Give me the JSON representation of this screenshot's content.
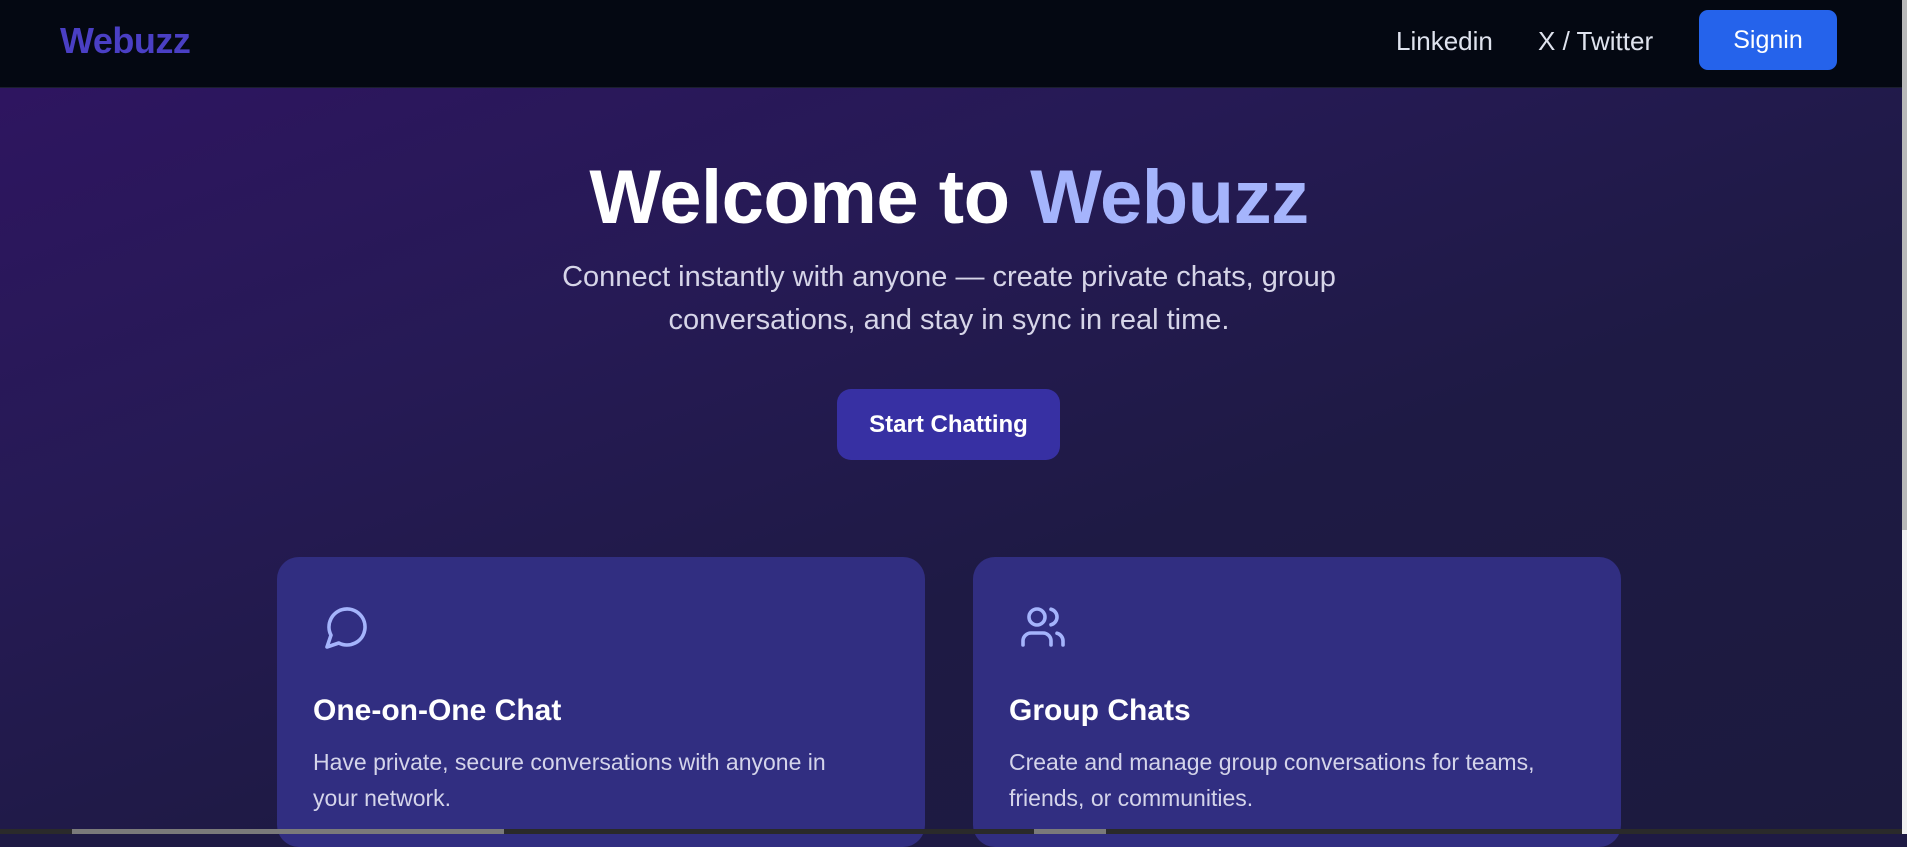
{
  "nav": {
    "logo": "Webuzz",
    "links": [
      "Linkedin",
      "X / Twitter"
    ],
    "signin_label": "Signin"
  },
  "hero": {
    "title_prefix": "Welcome to ",
    "title_accent": "Webuzz",
    "subtitle": "Connect instantly with anyone — create private chats, group conversations, and stay in sync in real time.",
    "cta_label": "Start Chatting"
  },
  "features": [
    {
      "icon": "chat-bubble-icon",
      "title": "One-on-One Chat",
      "description": "Have private, secure conversations with anyone in your network."
    },
    {
      "icon": "users-group-icon",
      "title": "Group Chats",
      "description": "Create and manage group conversations for teams, friends, or communities."
    }
  ],
  "colors": {
    "nav_bg": "#040812",
    "logo": "#4a3fc4",
    "signin": "#2563eb",
    "cta": "#3730a3",
    "card": "#312e81",
    "accent": "#a5b4fc"
  }
}
